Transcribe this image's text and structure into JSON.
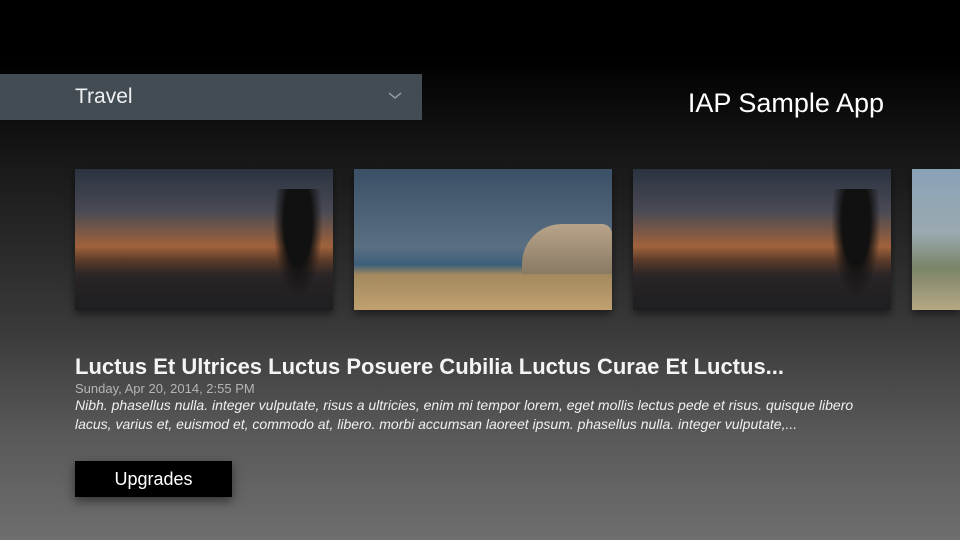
{
  "category_dropdown": {
    "selected": "Travel",
    "icon": "chevron-down-icon"
  },
  "header": {
    "title": "IAP Sample App"
  },
  "carousel": {
    "items": [
      {
        "image": "sunset"
      },
      {
        "image": "beach"
      },
      {
        "image": "sunset"
      },
      {
        "image": "landscape"
      }
    ]
  },
  "detail": {
    "title": "Luctus Et Ultrices Luctus Posuere Cubilia Luctus Curae Et Luctus...",
    "date": "Sunday, Apr 20, 2014, 2:55 PM",
    "description": "Nibh. phasellus nulla. integer vulputate, risus a ultricies, enim mi tempor lorem, eget mollis lectus pede et risus. quisque libero lacus, varius et, euismod et, commodo at, libero. morbi accumsan laoreet ipsum. phasellus nulla. integer vulputate,..."
  },
  "buttons": {
    "upgrades": "Upgrades"
  }
}
